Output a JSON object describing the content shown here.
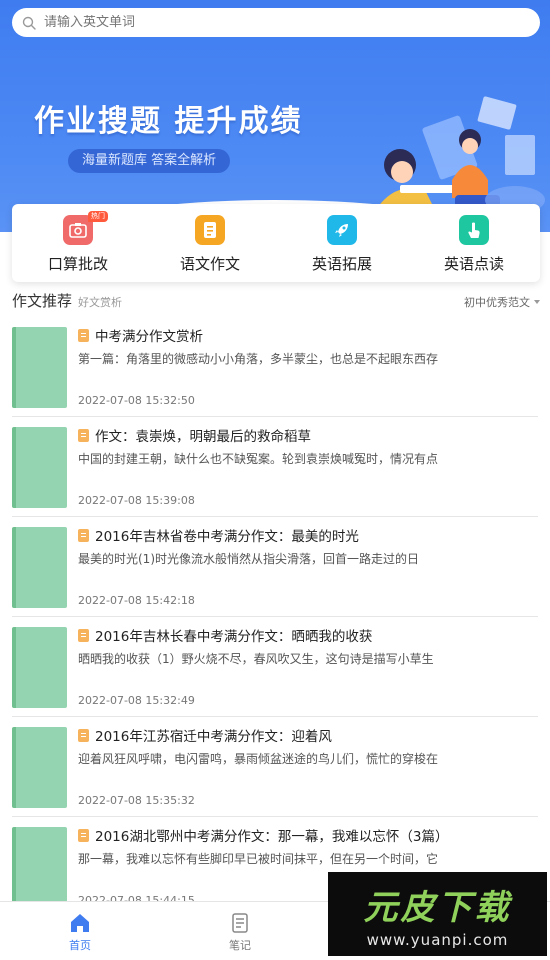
{
  "search": {
    "placeholder": "请输入英文单词"
  },
  "banner": {
    "title": "作业搜题 提升成绩",
    "subtitle": "海量新题库 答案全解析"
  },
  "quick_actions": [
    {
      "label": "口算批改",
      "icon": "camera-icon",
      "color": "#f06a6a",
      "badge": "热门"
    },
    {
      "label": "语文作文",
      "icon": "document-icon",
      "color": "#f5a623"
    },
    {
      "label": "英语拓展",
      "icon": "rocket-icon",
      "color": "#1fb8e8"
    },
    {
      "label": "英语点读",
      "icon": "touch-icon",
      "color": "#1fc7a0"
    }
  ],
  "section": {
    "title": "作文推荐",
    "subtitle": "好文赏析",
    "filter": "初中优秀范文"
  },
  "articles": [
    {
      "title": "中考满分作文赏析",
      "desc": "第一篇：角落里的微感动小小角落，多半蒙尘，也总是不起眼东西存",
      "time": "2022-07-08 15:32:50"
    },
    {
      "title": "作文：袁崇焕，明朝最后的救命稻草",
      "desc": "中国的封建王朝，缺什么也不缺冤案。轮到袁崇焕喊冤时，情况有点",
      "time": "2022-07-08 15:39:08"
    },
    {
      "title": "2016年吉林省卷中考满分作文：最美的时光",
      "desc": "最美的时光(1)时光像流水般悄然从指尖滑落，回首一路走过的日",
      "time": "2022-07-08 15:42:18"
    },
    {
      "title": "2016年吉林长春中考满分作文：晒晒我的收获",
      "desc": "晒晒我的收获（1）野火烧不尽，春风吹又生，这句诗是描写小草生",
      "time": "2022-07-08 15:32:49"
    },
    {
      "title": "2016年江苏宿迁中考满分作文：迎着风",
      "desc": "迎着风狂风呼啸，电闪雷鸣，暴雨倾盆迷途的鸟儿们，慌忙的穿梭在",
      "time": "2022-07-08 15:35:32"
    },
    {
      "title": "2016湖北鄂州中考满分作文：那一幕，我难以忘怀（3篇）",
      "desc": "那一幕，我难以忘怀有些脚印早已被时间抹平，但在另一个时间，它",
      "time": "2022-07-08 15:44:15"
    }
  ],
  "tabbar": [
    {
      "label": "首页",
      "active": true
    },
    {
      "label": "笔记",
      "active": false
    }
  ],
  "watermark": {
    "main": "元皮下载",
    "url": "www.yuanpi.com"
  },
  "colors": {
    "primary": "#3f7cf0",
    "thumb": "#94d4b0",
    "doc_icon": "#f7b35c"
  }
}
